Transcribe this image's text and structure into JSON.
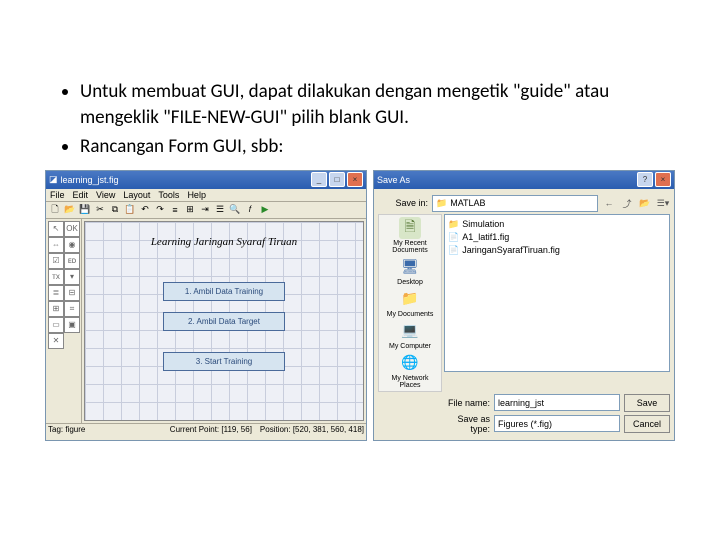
{
  "bullets": [
    "Untuk membuat GUI, dapat dilakukan dengan mengetik \"guide\" atau mengeklik \"FILE-NEW-GUI\" pilih blank GUI.",
    "Rancangan Form GUI, sbb:"
  ],
  "editor": {
    "title": "learning_jst.fig",
    "menu": [
      "File",
      "Edit",
      "View",
      "Layout",
      "Tools",
      "Help"
    ],
    "canvasTitle": "Learning Jaringan Syaraf Tiruan",
    "buttons": {
      "b1": "1. Ambil Data Training",
      "b2": "2. Ambil Data Target",
      "b3": "3. Start Training"
    },
    "status": {
      "tag": "Tag: figure",
      "point": "Current Point: [119, 56]",
      "pos": "Position: [520, 381, 560, 418]"
    }
  },
  "dialog": {
    "title": "Save As",
    "saveInLabel": "Save in:",
    "saveInValue": "MATLAB",
    "places": {
      "recent": "My Recent Documents",
      "desktop": "Desktop",
      "docs": "My Documents",
      "computer": "My Computer",
      "network": "My Network Places"
    },
    "files": {
      "f1": "Simulation",
      "f2": "A1_latif1.fig",
      "f3": "JaringanSyarafTiruan.fig"
    },
    "fileNameLabel": "File name:",
    "fileNameValue": "learning_jst",
    "saveTypeLabel": "Save as type:",
    "saveTypeValue": "Figures (*.fig)",
    "saveBtn": "Save",
    "cancelBtn": "Cancel"
  }
}
